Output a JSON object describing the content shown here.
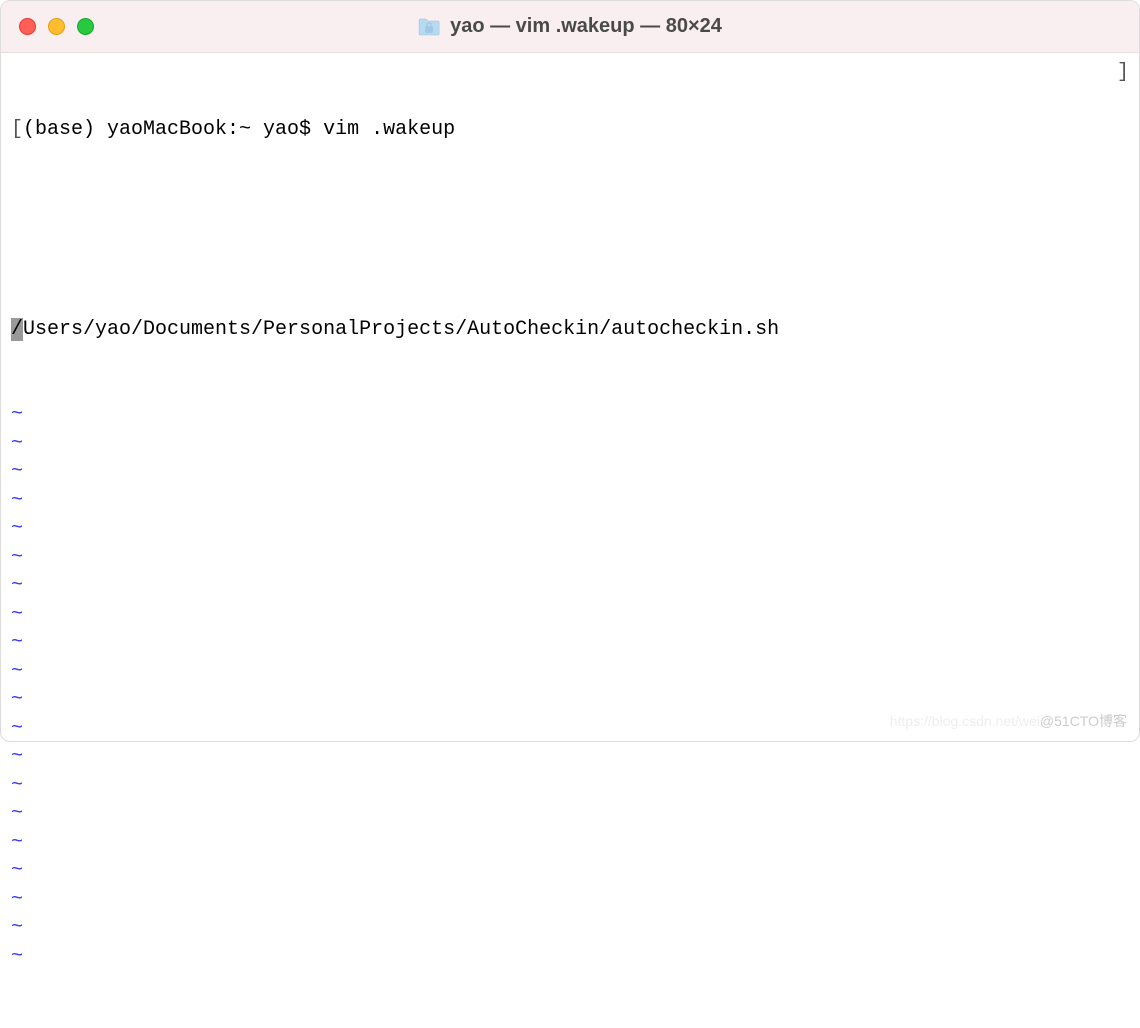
{
  "titlebar": {
    "title": "yao — vim .wakeup — 80×24"
  },
  "terminal": {
    "prompt_left_bracket": "[",
    "prompt_text": "(base) yaoMacBook:~ yao$ vim .wakeup",
    "prompt_right_bracket": "]",
    "cursor_char": "/",
    "file_content": "Users/yao/Documents/PersonalProjects/AutoCheckin/autocheckin.sh",
    "tilde": "~",
    "empty_line_count": 20
  },
  "watermark": {
    "faint": "https://blog.csdn.net/wei",
    "text": "@51CTO博客"
  }
}
